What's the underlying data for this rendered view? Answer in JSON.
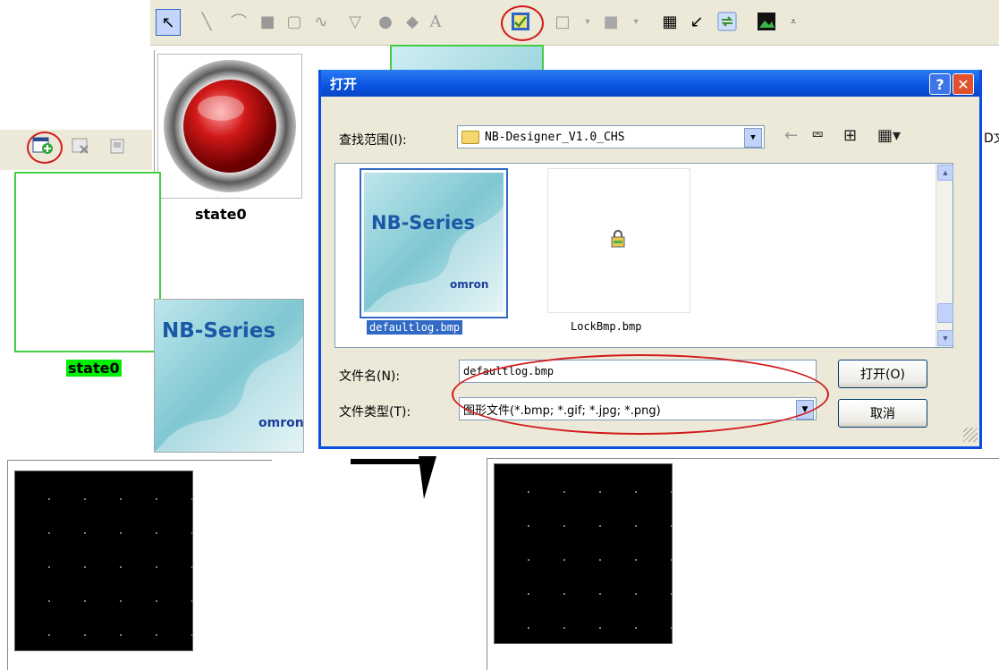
{
  "toolbar": {
    "icons": [
      "pointer-icon",
      "line-icon",
      "polyline-icon",
      "rectangle-icon",
      "rounded-rectangle-icon",
      "freehand-icon",
      "polygon-icon",
      "ellipse-icon",
      "diamond-icon",
      "text-icon",
      "bitmap-icon",
      "frame-icon",
      "fill-color-icon",
      "table-icon",
      "arrow-icon",
      "refresh-icon",
      "image-icon"
    ],
    "text_tool": "A"
  },
  "left_panel": {
    "state_label": "state0"
  },
  "state_panel": {
    "state_label": "state0"
  },
  "nb_thumb": {
    "title": "NB-Series",
    "brand": "omron"
  },
  "dialog": {
    "title": "打开",
    "help_label": "?",
    "close_label": "✕",
    "look_in_label": "查找范围(I):",
    "look_in_value": "NB-Designer_V1.0_CHS",
    "files": [
      {
        "name": "defaultlog.bmp",
        "selected": true,
        "thumb_title": "NB-Series",
        "thumb_brand": "omron"
      },
      {
        "name": "LockBmp.bmp",
        "selected": false
      }
    ],
    "filename_label": "文件名(N):",
    "filename_value": "defaultlog.bmp",
    "filetype_label": "文件类型(T):",
    "filetype_value": "图形文件(*.bmp; *.gif; *.jpg; *.png)",
    "open_button": "打开(O)",
    "cancel_button": "取消",
    "partial_right_text": "D文"
  },
  "colors": {
    "highlight_red": "#d21a1a",
    "selection_blue": "#316ac5",
    "state_green": "#00ee00"
  }
}
